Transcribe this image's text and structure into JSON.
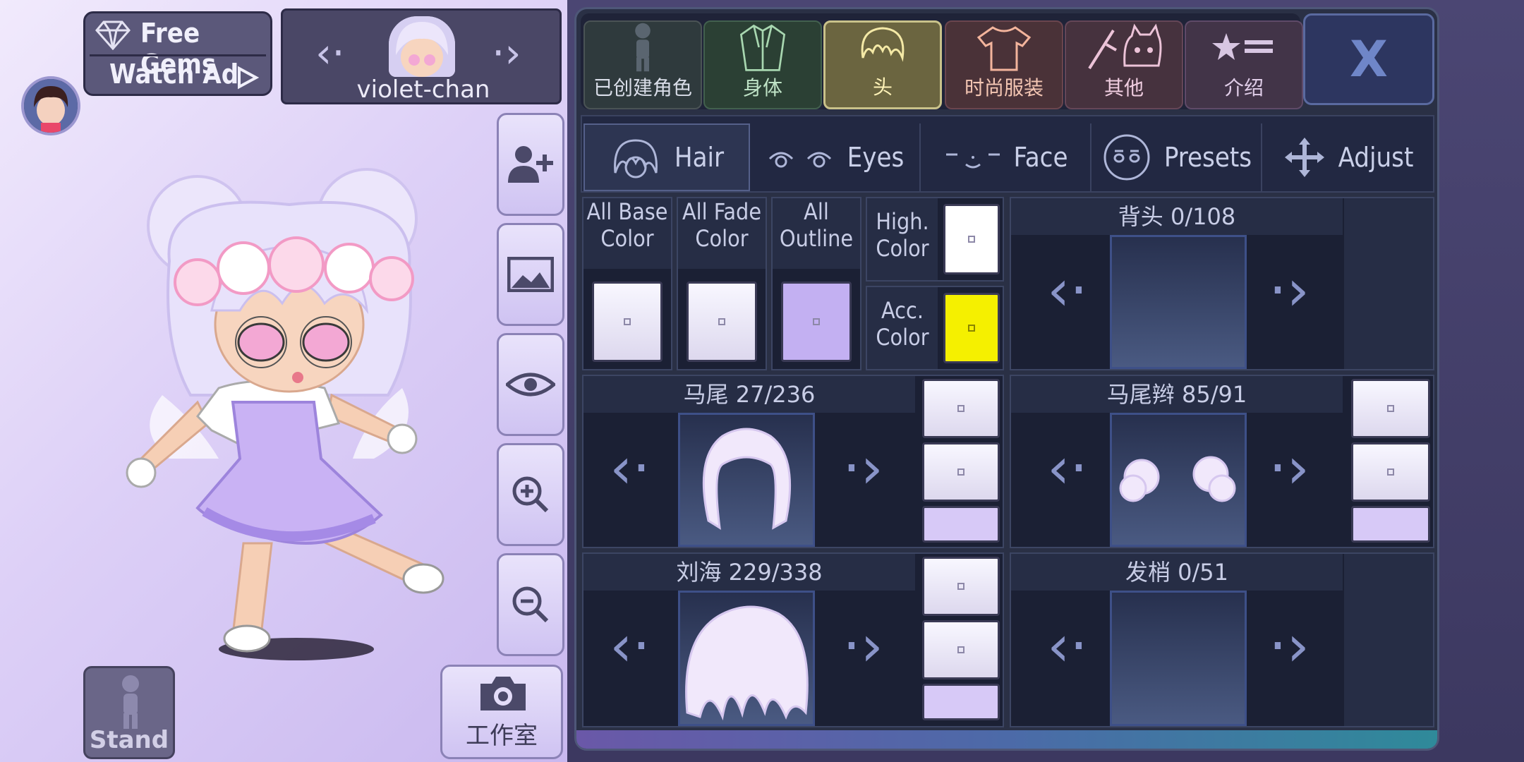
{
  "top_left": {
    "free_gems": "Free Gems",
    "watch_ad": "Watch Ad",
    "character_name": "violet-chan"
  },
  "left_tools": {
    "stand_label": "Stand",
    "studio_label": "工作室"
  },
  "category_tabs": [
    "已创建角色",
    "身体",
    "头",
    "时尚服装",
    "其他",
    "介绍"
  ],
  "close_label": "X",
  "sub_tabs": [
    "Hair",
    "Eyes",
    "Face",
    "Presets",
    "Adjust"
  ],
  "color_options": {
    "all_base": "All Base\nColor",
    "all_fade": "All Fade\nColor",
    "all_outline": "All\nOutline",
    "high": "High.\nColor",
    "acc": "Acc.\nColor"
  },
  "parts": {
    "back_hair": "背头 0/108",
    "ponytail": "马尾 27/236",
    "braid": "马尾辫 85/91",
    "bangs": "刘海 229/338",
    "hair_tips": "发梢 0/51"
  },
  "colors": {
    "high_color": "#ffffff",
    "acc_color": "#f5f000",
    "selected_tab": "#6b6540"
  }
}
